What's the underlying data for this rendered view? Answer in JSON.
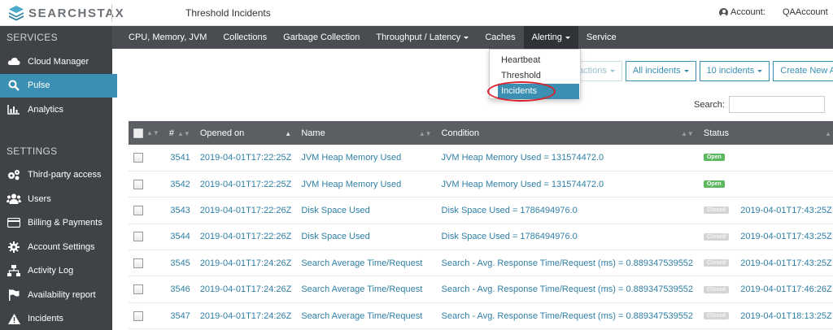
{
  "header": {
    "logo_text": "SEARCHSTAX",
    "page_title": "Threshold Incidents",
    "account_label": "Account:",
    "account_user": "QAAccount"
  },
  "sidebar": {
    "services_heading": "SERVICES",
    "services": [
      {
        "label": "Cloud Manager",
        "icon": "cloud-icon"
      },
      {
        "label": "Pulse",
        "icon": "search-icon"
      },
      {
        "label": "Analytics",
        "icon": "bar-chart-icon"
      }
    ],
    "settings_heading": "SETTINGS",
    "settings": [
      {
        "label": "Third-party access",
        "icon": "cogs-icon"
      },
      {
        "label": "Users",
        "icon": "users-icon"
      },
      {
        "label": "Billing & Payments",
        "icon": "credit-card-icon"
      },
      {
        "label": "Account Settings",
        "icon": "gear-icon"
      },
      {
        "label": "Activity Log",
        "icon": "sitemap-icon"
      },
      {
        "label": "Availability report",
        "icon": "flag-icon"
      },
      {
        "label": "Incidents",
        "icon": "warning-icon"
      }
    ],
    "active_color": "#3a8fb2"
  },
  "nav": {
    "items": [
      {
        "label": "CPU, Memory, JVM"
      },
      {
        "label": "Collections"
      },
      {
        "label": "Garbage Collection"
      },
      {
        "label": "Throughput / Latency"
      },
      {
        "label": "Caches"
      },
      {
        "label": "Alerting"
      },
      {
        "label": "Service"
      }
    ]
  },
  "dropdown": {
    "items": [
      "Heartbeat",
      "Threshold",
      "Incidents"
    ],
    "selected": "Incidents"
  },
  "toolbar": {
    "actions_label": "actions",
    "filter_label": "All incidents",
    "page_size_label": "10 incidents",
    "create_label": "Create New Alert",
    "search_label": "Search:",
    "search_value": ""
  },
  "table": {
    "headers": {
      "id": "#",
      "opened": "Opened on",
      "name": "Name",
      "condition": "Condition",
      "status": "Status"
    },
    "rows": [
      {
        "id": "3541",
        "opened": "2019-04-01T17:22:25Z",
        "name": "JVM Heap Memory Used",
        "condition": "JVM Heap Memory Used = 131574472.0",
        "status": "Open",
        "closed_on": ""
      },
      {
        "id": "3542",
        "opened": "2019-04-01T17:22:25Z",
        "name": "JVM Heap Memory Used",
        "condition": "JVM Heap Memory Used = 131574472.0",
        "status": "Open",
        "closed_on": ""
      },
      {
        "id": "3543",
        "opened": "2019-04-01T17:22:26Z",
        "name": "Disk Space Used",
        "condition": "Disk Space Used = 1786494976.0",
        "status": "Closed",
        "closed_on": "2019-04-01T17:43:25Z"
      },
      {
        "id": "3544",
        "opened": "2019-04-01T17:22:26Z",
        "name": "Disk Space Used",
        "condition": "Disk Space Used = 1786494976.0",
        "status": "Closed",
        "closed_on": "2019-04-01T17:43:25Z"
      },
      {
        "id": "3545",
        "opened": "2019-04-01T17:24:26Z",
        "name": "Search Average Time/Request",
        "condition": "Search - Avg. Response Time/Request (ms) = 0.889347539552",
        "status": "Closed",
        "closed_on": "2019-04-01T17:43:25Z"
      },
      {
        "id": "3546",
        "opened": "2019-04-01T17:24:26Z",
        "name": "Search Average Time/Request",
        "condition": "Search - Avg. Response Time/Request (ms) = 0.889347539552",
        "status": "Closed",
        "closed_on": "2019-04-01T17:46:26Z"
      },
      {
        "id": "3547",
        "opened": "2019-04-01T17:24:26Z",
        "name": "Search Average Time/Request",
        "condition": "Search - Avg. Response Time/Request (ms) = 0.889347539552",
        "status": "Closed",
        "closed_on": "2019-04-01T18:13:25Z"
      }
    ]
  },
  "colors": {
    "link": "#2f7fa5",
    "open_badge": "#5cb85c",
    "closed_badge": "#d4d4d4",
    "highlight": "#d9232e"
  }
}
